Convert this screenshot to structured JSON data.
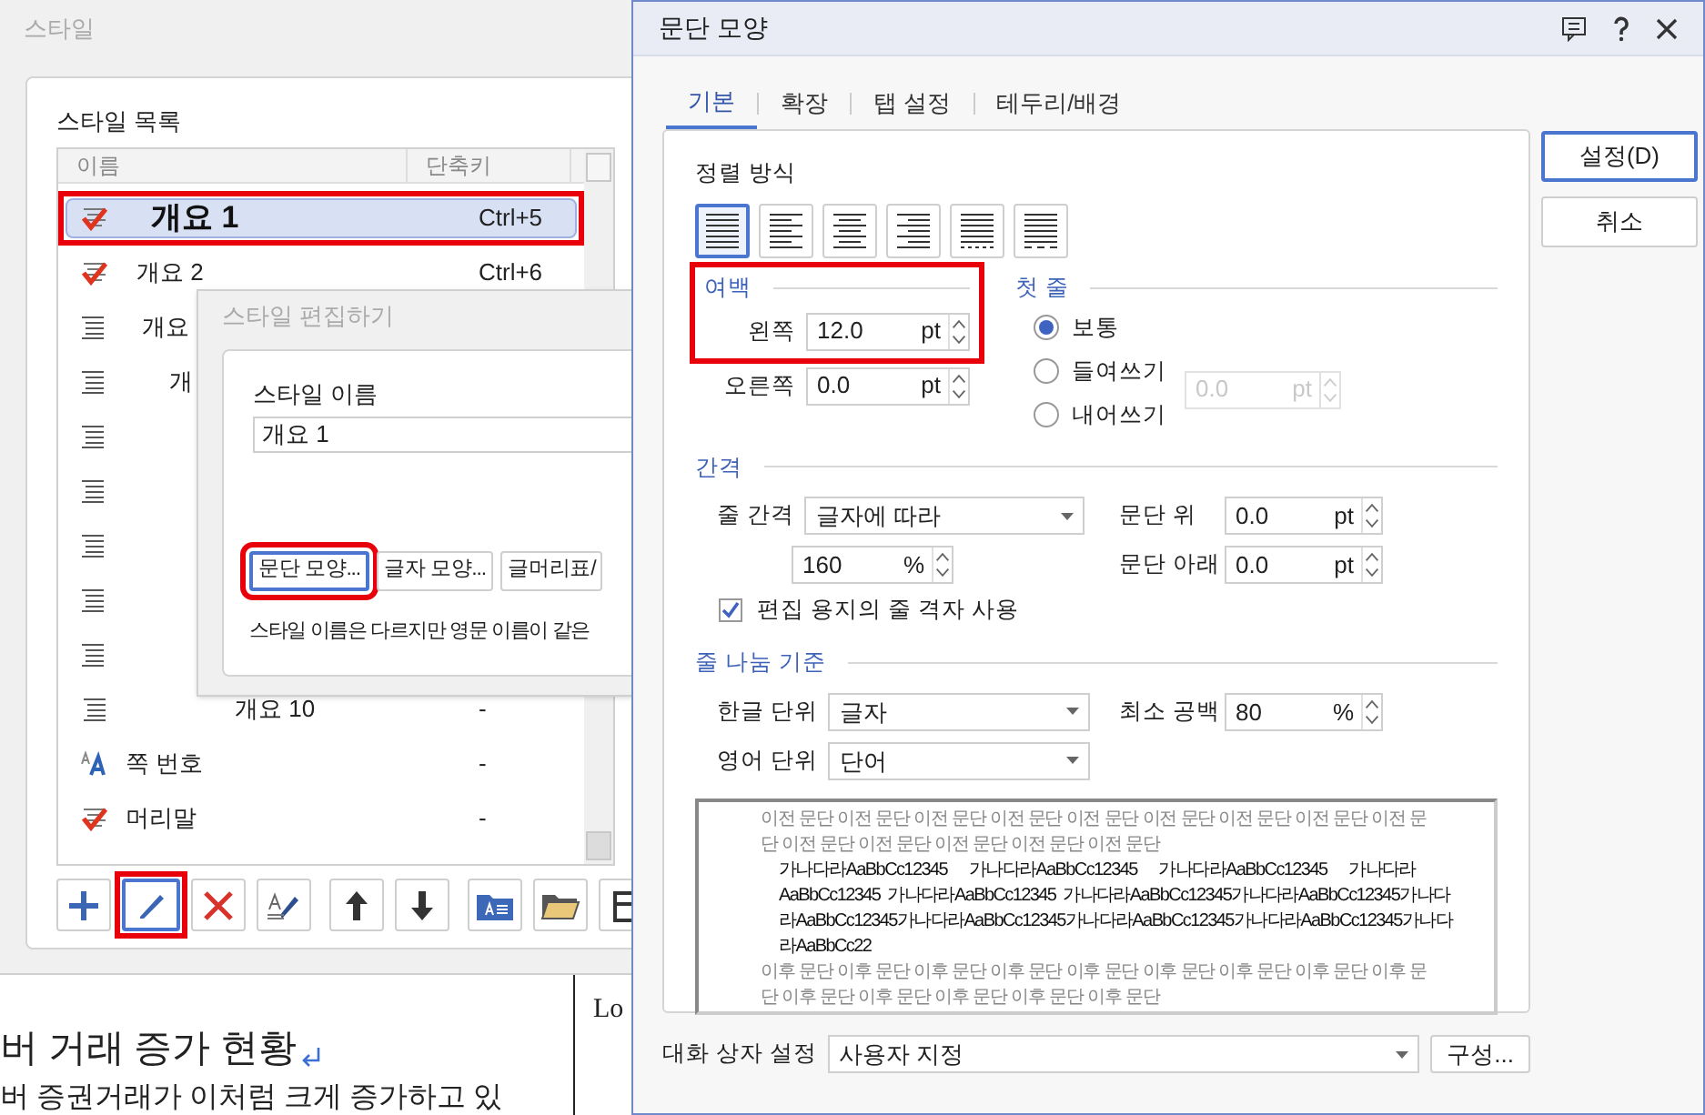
{
  "style_window": {
    "title": "스타일",
    "list_label": "스타일 목록",
    "columns": [
      "이름",
      "단축키"
    ],
    "rows": [
      {
        "kind": "check",
        "name": "개요 1",
        "shortcut": "Ctrl+5",
        "selected": true,
        "highlighted": true
      },
      {
        "kind": "check",
        "name": "개요 2",
        "shortcut": "Ctrl+6",
        "selected": false,
        "highlighted": false
      },
      {
        "kind": "para",
        "name": "개요",
        "selected": false,
        "highlighted": false
      },
      {
        "kind": "para",
        "name": "개",
        "selected": false,
        "highlighted": false
      },
      {
        "kind": "para",
        "selected": false,
        "highlighted": false
      },
      {
        "kind": "para",
        "selected": false,
        "highlighted": false
      },
      {
        "kind": "para",
        "selected": false,
        "highlighted": false
      },
      {
        "kind": "para",
        "selected": false,
        "highlighted": false
      },
      {
        "kind": "para",
        "selected": false,
        "highlighted": false
      },
      {
        "kind": "para",
        "name": "개요 10",
        "shortcut": "-",
        "selected": false,
        "highlighted": false
      },
      {
        "kind": "char",
        "name": "쪽 번호",
        "shortcut": "-",
        "selected": false,
        "highlighted": false
      },
      {
        "kind": "check",
        "name": "머리말",
        "shortcut": "-",
        "selected": false,
        "highlighted": false
      }
    ],
    "tools": [
      {
        "kind": "add",
        "selected": false,
        "highlighted": false
      },
      {
        "kind": "edit",
        "selected": true,
        "highlighted": true
      },
      {
        "kind": "delete",
        "selected": false,
        "highlighted": false
      },
      {
        "kind": "eyedropper",
        "selected": false,
        "highlighted": false
      },
      {
        "kind": "up",
        "selected": false,
        "highlighted": false
      },
      {
        "kind": "down",
        "selected": false,
        "highlighted": false
      },
      {
        "kind": "folder_doc",
        "selected": false,
        "highlighted": false
      },
      {
        "kind": "folder",
        "selected": false,
        "highlighted": false
      },
      {
        "kind": "save",
        "selected": false,
        "highlighted": false
      }
    ]
  },
  "document": {
    "heading": "버 거래 증가 현황",
    "body": "버 증권거래가 이처럼 크게 증가하고 있",
    "side_text": "Lo"
  },
  "edit_dialog": {
    "title": "스타일 편집하기",
    "name_label": "스타일 이름",
    "name_value": "개요 1",
    "buttons": [
      {
        "label": "문단 모양...",
        "highlighted": true
      },
      {
        "label": "글자 모양...",
        "highlighted": false
      },
      {
        "label": "글머리표/",
        "highlighted": false
      }
    ],
    "note": "스타일 이름은 다르지만 영문 이름이 같은"
  },
  "paragraph_dialog": {
    "title": "문단 모양",
    "tabs": [
      {
        "label": "기본",
        "selected": true
      },
      {
        "label": "확장",
        "selected": false
      },
      {
        "label": "탭 설정",
        "selected": false
      },
      {
        "label": "테두리/배경",
        "selected": false
      }
    ],
    "buttons": [
      {
        "label": "설정(D)",
        "primary": true
      },
      {
        "label": "취소",
        "primary": false
      }
    ],
    "alignment": {
      "label": "정렬 방식",
      "options": [
        {
          "kind": "justify",
          "selected": true
        },
        {
          "kind": "left",
          "selected": false
        },
        {
          "kind": "center",
          "selected": false
        },
        {
          "kind": "right",
          "selected": false
        },
        {
          "kind": "distribute",
          "selected": false
        },
        {
          "kind": "divide",
          "selected": false
        }
      ]
    },
    "margin": {
      "label": "여백",
      "highlighted": true,
      "left": {
        "label": "왼쪽",
        "value": "12.0",
        "unit": "pt"
      },
      "right": {
        "label": "오른쪽",
        "value": "0.0",
        "unit": "pt"
      }
    },
    "first_line": {
      "label": "첫 줄",
      "options": [
        {
          "label": "보통",
          "selected": true
        },
        {
          "label": "들여쓰기",
          "selected": false
        },
        {
          "label": "내어쓰기",
          "selected": false
        }
      ],
      "value": "0.0",
      "unit": "pt",
      "disabled": true
    },
    "spacing": {
      "label": "간격",
      "line_spacing_label": "줄 간격",
      "line_spacing_type": "글자에 따라",
      "line_spacing_value": "160",
      "line_spacing_unit": "%",
      "above": {
        "label": "문단 위",
        "value": "0.0",
        "unit": "pt"
      },
      "below": {
        "label": "문단 아래",
        "value": "0.0",
        "unit": "pt"
      },
      "grid": {
        "label": "편집 용지의 줄 격자 사용",
        "checked": true
      }
    },
    "line_break": {
      "label": "줄 나눔 기준",
      "korean": {
        "label": "한글 단위",
        "value": "글자"
      },
      "english": {
        "label": "영어 단위",
        "value": "단어"
      },
      "min_space": {
        "label": "최소 공백",
        "value": "80",
        "unit": "%"
      }
    },
    "preview": {
      "before": [
        "이전 문단 이전 문단 이전 문단 이전 문단 이전 문단 이전 문단 이전 문단 이전 문단 이전 문",
        "단 이전 문단 이전 문단 이전 문단 이전 문단 이전 문단"
      ],
      "sample": [
        "가나다라AaBbCc12345      가나다라AaBbCc12345      가나다라AaBbCc12345      가나다라",
        "AaBbCc12345  가나다라AaBbCc12345  가나다라AaBbCc12345가나다라AaBbCc12345가나다",
        "라AaBbCc12345가나다라AaBbCc12345가나다라AaBbCc12345가나다라AaBbCc12345가나다",
        "라AaBbCc22"
      ],
      "after": [
        "이후 문단 이후 문단 이후 문단 이후 문단 이후 문단 이후 문단 이후 문단 이후 문단 이후 문",
        "단 이후 문단 이후 문단 이후 문단 이후 문단 이후 문단"
      ]
    },
    "dialog_setting": {
      "label": "대화 상자 설정",
      "value": "사용자 지정",
      "button": "구성..."
    }
  }
}
